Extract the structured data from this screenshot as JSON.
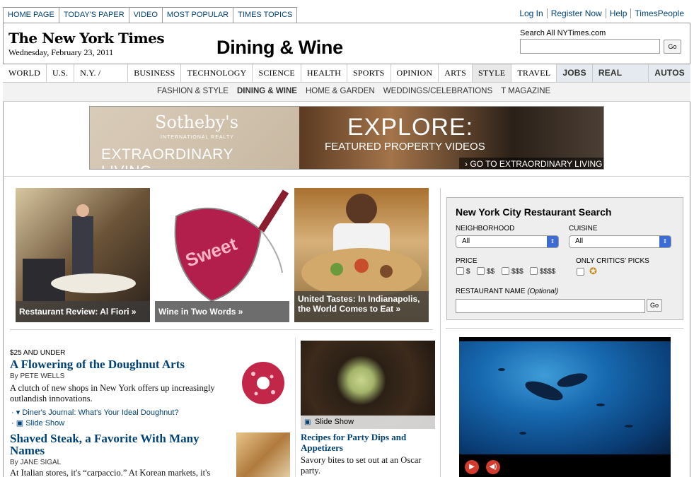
{
  "top_tabs": [
    "HOME PAGE",
    "TODAY'S PAPER",
    "VIDEO",
    "MOST POPULAR",
    "TIMES TOPICS"
  ],
  "account_links": [
    "Log In",
    "Register Now",
    "Help",
    "TimesPeople"
  ],
  "masthead": {
    "logo": "The New York Times",
    "date": "Wednesday, February 23, 2011",
    "section": "Dining & Wine"
  },
  "search": {
    "label": "Search All NYTimes.com",
    "value": "",
    "go": "Go"
  },
  "main_nav": [
    "WORLD",
    "U.S.",
    "N.Y. / REGION",
    "BUSINESS",
    "TECHNOLOGY",
    "SCIENCE",
    "HEALTH",
    "SPORTS",
    "OPINION",
    "ARTS",
    "STYLE",
    "TRAVEL",
    "JOBS",
    "REAL ESTATE",
    "AUTOS"
  ],
  "sub_nav": [
    "FASHION & STYLE",
    "DINING & WINE",
    "HOME & GARDEN",
    "WEDDINGS/CELEBRATIONS",
    "T MAGAZINE"
  ],
  "banner": {
    "brand": "Sotheby's",
    "brand_sub": "INTERNATIONAL REALTY",
    "tagline": "EXTRAORDINARY LIVING",
    "headline": "EXPLORE:",
    "sub": "FEATURED PROPERTY VIDEOS",
    "cta": "› GO TO EXTRAORDINARY LIVING"
  },
  "promos": [
    {
      "caption": "Restaurant Review: Al Fiori »"
    },
    {
      "caption": "Wine in Two Words »"
    },
    {
      "caption": "United Tastes: In Indianapolis, the World Comes to Eat »"
    }
  ],
  "restaurant_search": {
    "title": "New York City Restaurant Search",
    "neighborhood_label": "NEIGHBORHOOD",
    "neighborhood_value": "All",
    "cuisine_label": "CUISINE",
    "cuisine_value": "All",
    "price_label": "PRICE",
    "prices": [
      "$",
      "$$",
      "$$$",
      "$$$$"
    ],
    "critics_label": "ONLY CRITICS' PICKS",
    "name_label": "RESTAURANT NAME",
    "name_optional": "(Optional)",
    "go": "Go"
  },
  "article1": {
    "kicker": "$25 AND UNDER",
    "headline": "A Flowering of the Doughnut Arts",
    "byline": "By PETE WELLS",
    "summary": "A clutch of new shops in New York offers up increasingly outlandish innovations.",
    "related": [
      "Diner's Journal: What's Your Ideal Doughnut?",
      "Slide Show"
    ]
  },
  "article2": {
    "headline": "Shaved Steak, a Favorite With Many Names",
    "byline": "By JANE SIGAL",
    "summary": "At Italian stores, it's “carpaccio.” At Korean markets, it's"
  },
  "article3": {
    "image_caption": "Slide Show",
    "headline": "Recipes for Party Dips and Appetizers",
    "summary": "Savory bites to set out at an Oscar party."
  },
  "colors": {
    "link": "#004276",
    "accent_red": "#d23b2e"
  }
}
